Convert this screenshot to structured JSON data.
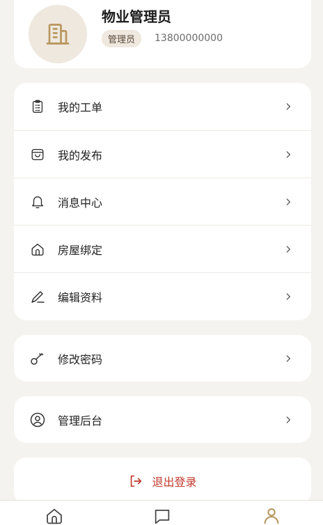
{
  "profile": {
    "name": "物业管理员",
    "role": "管理员",
    "phone": "13800000000",
    "avatar_icon": "building-icon"
  },
  "menu": {
    "items": [
      {
        "label": "我的工单",
        "icon": "clipboard-icon"
      },
      {
        "label": "我的发布",
        "icon": "bag-icon"
      },
      {
        "label": "消息中心",
        "icon": "bell-icon"
      },
      {
        "label": "房屋绑定",
        "icon": "home-icon"
      },
      {
        "label": "编辑资料",
        "icon": "pen-icon"
      }
    ]
  },
  "security": {
    "label": "修改密码",
    "icon": "key-icon"
  },
  "admin": {
    "label": "管理后台",
    "icon": "user-circle-icon"
  },
  "logout": {
    "label": "退出登录",
    "icon": "logout-icon"
  },
  "tabbar": {
    "tabs": [
      {
        "icon": "home-icon",
        "active": false
      },
      {
        "icon": "message-icon",
        "active": false
      },
      {
        "icon": "user-icon",
        "active": true
      }
    ]
  },
  "colors": {
    "accent": "#b8975f",
    "logout": "#c0392b",
    "background": "#f5f3ef",
    "badge": "#efe8df"
  }
}
